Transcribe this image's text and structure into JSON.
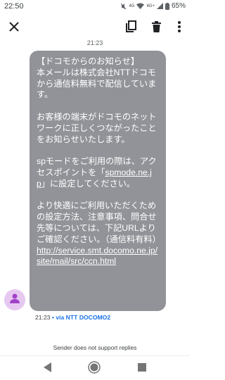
{
  "status_bar": {
    "time": "22:50",
    "battery": "65%",
    "network_4g": "4G",
    "network_4g_plus": "4G+"
  },
  "toolbar": {
    "close_icon": "close-icon",
    "copy_icon": "copy-icon",
    "delete_icon": "trash-icon",
    "more_icon": "more-vert-icon"
  },
  "conversation": {
    "date_stamp": "21:23",
    "message": {
      "line1": "【ドコモからのお知らせ】",
      "line2": "本メールは株式会社NTTドコモから通信料無料で配信しています。",
      "para2": "お客様の端末がドコモのネットワークに正しくつながったことをお知らせいたします。",
      "para3_a": "spモードをご利用の際は、アクセスポイントを「",
      "para3_link": "spmode.ne.jp",
      "para3_b": "」に設定してください。",
      "para4": "より快適にご利用いただくための設定方法、注意事項、問合せ先等については、下記URLよりご確認ください。（通信料有料）",
      "url": "http://service.smt.docomo.ne.jp/site/mail/src/ccn.html"
    },
    "meta_time": "21:23",
    "meta_sep": " • ",
    "meta_via": "via NTT DOCOMO2",
    "no_reply_notice": "Sender does not support replies"
  },
  "colors": {
    "bubble": "#919398",
    "avatar_bg": "#e6c8f0",
    "avatar_fg": "#a142c9",
    "via_link": "#1a73e8"
  }
}
